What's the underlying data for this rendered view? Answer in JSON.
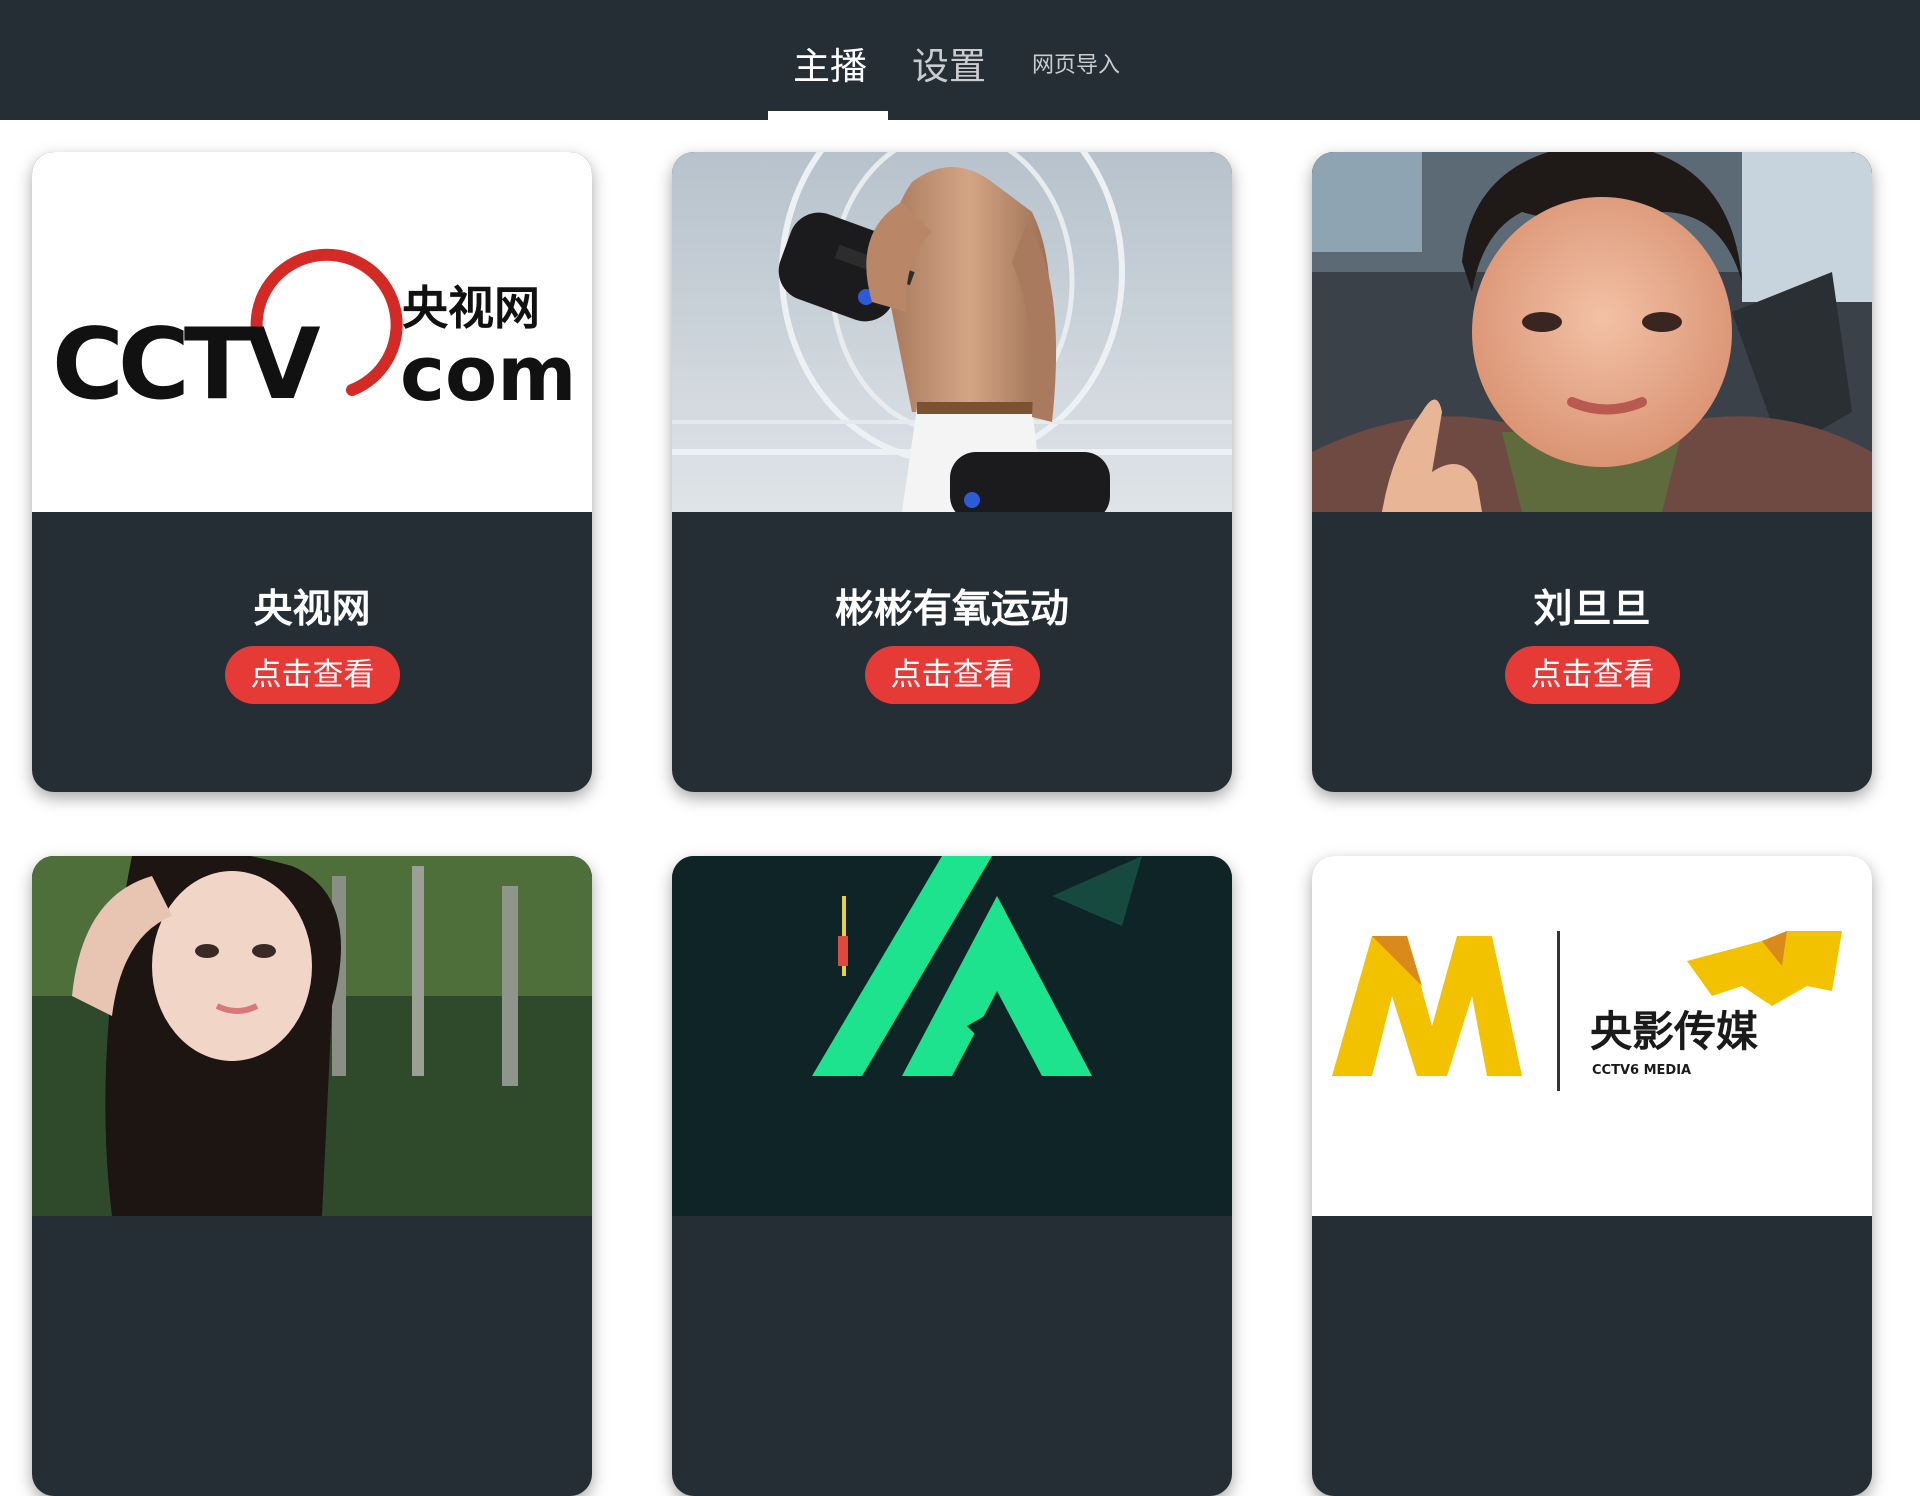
{
  "tabs": {
    "streamer": "主播",
    "settings": "设置",
    "web_import": "网页导入"
  },
  "cards": [
    {
      "title": "央视网",
      "button": "点击查看",
      "logo_cn": "央视网",
      "logo_en_a": "CCTV",
      "logo_en_b": "com"
    },
    {
      "title": "彬彬有氧运动",
      "button": "点击查看"
    },
    {
      "title": "刘旦旦",
      "button": "点击查看"
    },
    {
      "title": "",
      "button": ""
    },
    {
      "title": "",
      "button": ""
    },
    {
      "title": "",
      "button": "",
      "logo_cn": "央影传媒",
      "logo_en": "CCTV6 MEDIA"
    }
  ],
  "colors": {
    "bar": "#262e35",
    "button": "#e63a36",
    "accent_green": "#1de38f",
    "logo_red": "#d42a26",
    "logo_yellow": "#f2c200"
  },
  "icons": {
    "cctv": "cctv-logo-icon",
    "fitness": "dumbbell-photo",
    "portrait": "portrait-photo",
    "green_logo": "green-triangle-logo-icon",
    "media_logo": "m-logo-icon"
  }
}
